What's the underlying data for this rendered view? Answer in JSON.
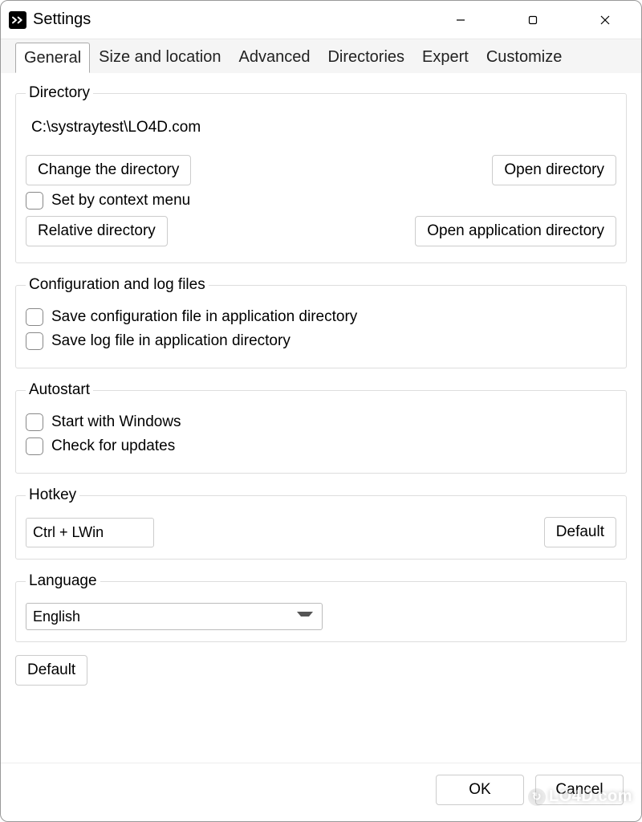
{
  "window": {
    "title": "Settings"
  },
  "tabs": [
    {
      "label": "General",
      "active": true
    },
    {
      "label": "Size and location"
    },
    {
      "label": "Advanced"
    },
    {
      "label": "Directories"
    },
    {
      "label": "Expert"
    },
    {
      "label": "Customize"
    }
  ],
  "directory": {
    "legend": "Directory",
    "path": "C:\\systraytest\\LO4D.com",
    "change_label": "Change the directory",
    "open_label": "Open directory",
    "set_by_context_label": "Set by context menu",
    "relative_label": "Relative directory",
    "open_app_dir_label": "Open application directory"
  },
  "config": {
    "legend": "Configuration and log files",
    "save_config_label": "Save configuration file in application directory",
    "save_log_label": "Save log file in application directory"
  },
  "autostart": {
    "legend": "Autostart",
    "start_windows_label": "Start with Windows",
    "check_updates_label": "Check for updates"
  },
  "hotkey": {
    "legend": "Hotkey",
    "value": "Ctrl + LWin",
    "default_label": "Default"
  },
  "language": {
    "legend": "Language",
    "value": "English"
  },
  "default_button_label": "Default",
  "footer": {
    "ok_label": "OK",
    "cancel_label": "Cancel"
  },
  "watermark": "LO4D.com"
}
